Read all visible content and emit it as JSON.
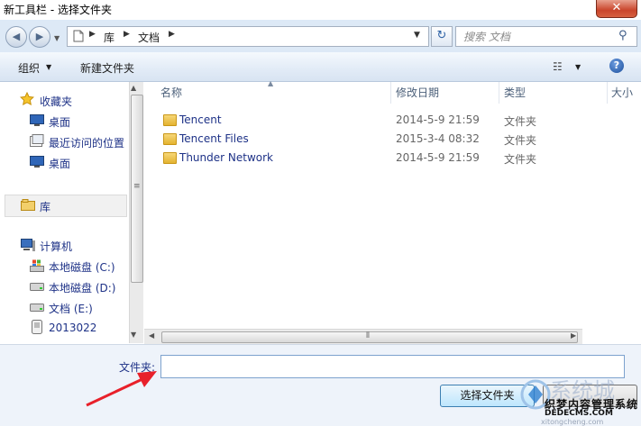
{
  "window": {
    "title": "新工具栏 - 选择文件夹",
    "close_glyph": "✕"
  },
  "nav": {
    "back_glyph": "◀",
    "forward_glyph": "▶",
    "history_glyph": "▼",
    "address_icon": "document-icon",
    "breadcrumb": [
      "库",
      "文档"
    ],
    "crumb_sep": "▶",
    "dropdown_glyph": "▼",
    "refresh_glyph": "↻",
    "search_placeholder": "搜索 文档",
    "search_glyph": "⚲"
  },
  "toolbar": {
    "organize_label": "组织",
    "organize_caret": "▼",
    "new_folder_label": "新建文件夹",
    "view_glyph": "☷",
    "view_caret": "▼",
    "help_glyph": "?"
  },
  "sidebar": {
    "favorites": {
      "label": "收藏夹",
      "icon": "star-icon"
    },
    "favorites_items": [
      {
        "label": "桌面",
        "icon": "desktop-icon"
      },
      {
        "label": "最近访问的位置",
        "icon": "recent-places-icon"
      },
      {
        "label": "桌面",
        "icon": "desktop-icon"
      }
    ],
    "libraries": {
      "label": "库",
      "icon": "library-icon"
    },
    "computer": {
      "label": "计算机",
      "icon": "computer-icon"
    },
    "computer_items": [
      {
        "label": "本地磁盘 (C:)",
        "icon": "system-drive-icon"
      },
      {
        "label": "本地磁盘 (D:)",
        "icon": "drive-icon"
      },
      {
        "label": "文档 (E:)",
        "icon": "drive-icon"
      },
      {
        "label": "2013022",
        "icon": "removable-device-icon"
      }
    ]
  },
  "filelist": {
    "columns": [
      "名称",
      "修改日期",
      "类型",
      "大小"
    ],
    "sort_glyph": "▲",
    "rows": [
      {
        "name": "Tencent",
        "date": "2014-5-9 21:59",
        "type": "文件夹"
      },
      {
        "name": "Tencent Files",
        "date": "2015-3-4 08:32",
        "type": "文件夹"
      },
      {
        "name": "Thunder Network",
        "date": "2014-5-9 21:59",
        "type": "文件夹"
      }
    ]
  },
  "scroll": {
    "up": "▲",
    "down": "▼",
    "left": "◀",
    "right": "▶",
    "grip_v": "≡",
    "grip_h": "⦀"
  },
  "footer": {
    "folder_label": "文件夹:",
    "folder_value": "",
    "select_label": "选择文件夹"
  },
  "watermark": {
    "big": "系统城",
    "cn": "织梦内容管理系统",
    "domain": "DEDECMS.COM",
    "sub": "xitongcheng.com"
  },
  "colors": {
    "accent": "#1e3287",
    "annotation_red": "#e8202a",
    "nav_bg": "#dde9f6"
  }
}
